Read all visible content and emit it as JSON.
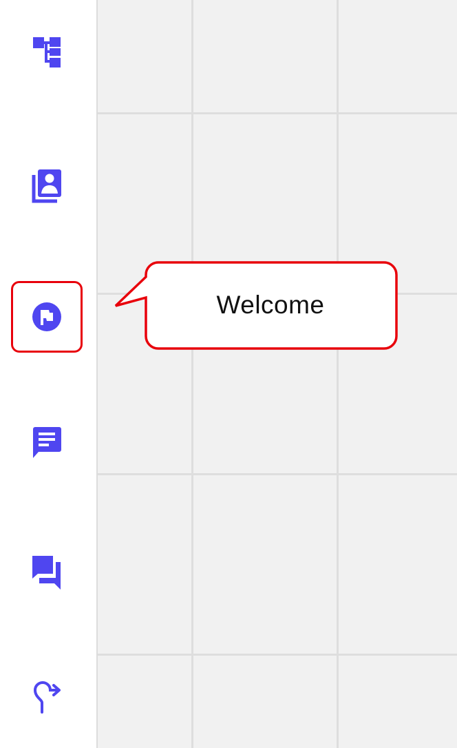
{
  "sidebar": {
    "items": [
      {
        "id": "tree",
        "icon": "flow-tree-icon"
      },
      {
        "id": "contacts",
        "icon": "contact-book-icon"
      },
      {
        "id": "welcome",
        "icon": "flag-circle-icon",
        "selected": true
      },
      {
        "id": "message",
        "icon": "message-icon"
      },
      {
        "id": "conversations",
        "icon": "forum-icon"
      },
      {
        "id": "redirect",
        "icon": "redirect-arrow-icon"
      }
    ],
    "icon_color": "#4f46f0"
  },
  "callout": {
    "text": "Welcome",
    "border_color": "#e8000b"
  }
}
